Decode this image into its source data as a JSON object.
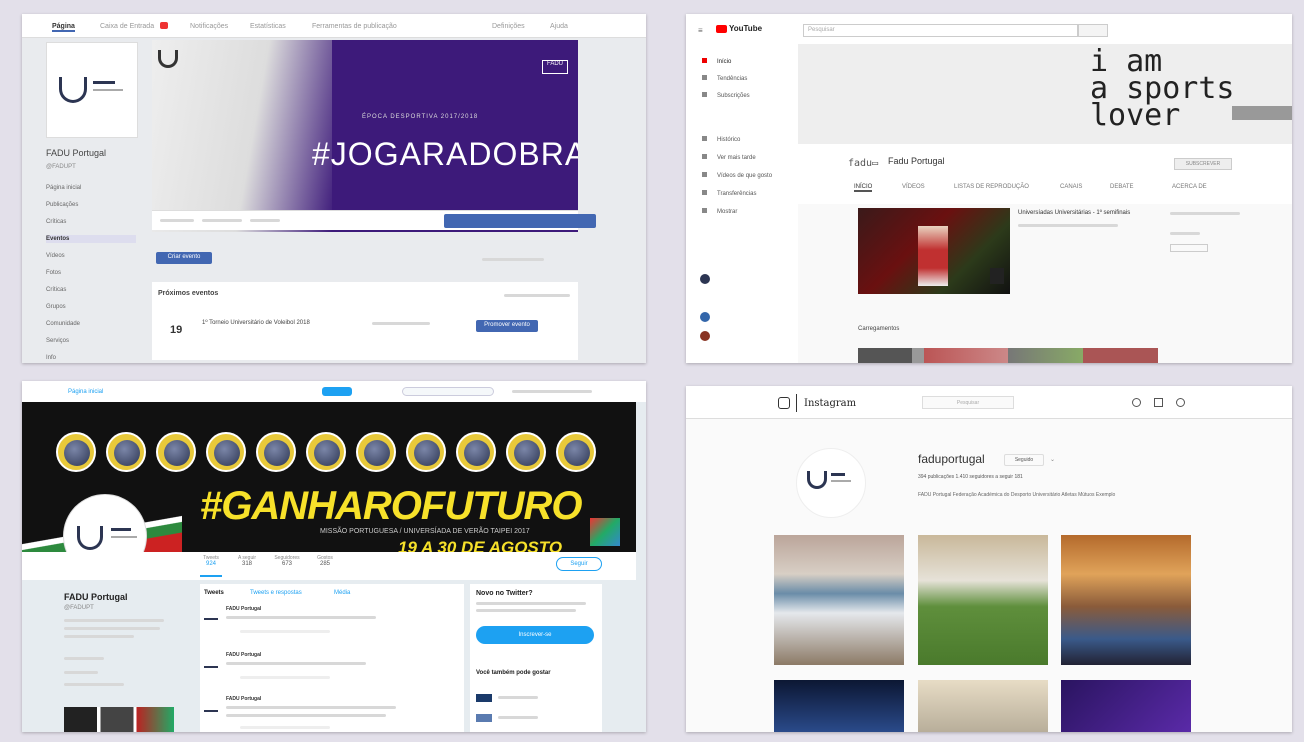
{
  "facebook": {
    "tabs": [
      "Página",
      "Caixa de Entrada",
      "Notificações",
      "Estatísticas",
      "Ferramentas de publicação",
      "Definições",
      "Ajuda"
    ],
    "page_name": "FADU Portugal",
    "handle": "@FADUPT",
    "nav": [
      "Página inicial",
      "Publicações",
      "Críticas",
      "Eventos",
      "Vídeos",
      "Fotos",
      "Críticas",
      "Grupos",
      "Comunidade",
      "Serviços",
      "Info"
    ],
    "nav_selected_index": 3,
    "cover_tagline": "ÉPOCA DESPORTIVA 2017/2018",
    "cover_hashtag": "#JOGARADOBRAR",
    "cover_badge": "FADU",
    "create_event": "Criar evento",
    "upcoming_title": "Próximos eventos",
    "event_day": "19",
    "event_title": "1º Torneio Universitário de Voleibol 2018",
    "promote": "Promover evento"
  },
  "youtube": {
    "logo": "YouTube",
    "search_placeholder": "Pesquisar",
    "nav": [
      "Início",
      "Tendências",
      "Subscrições",
      "Histórico",
      "Ver mais tarde",
      "Vídeos de que gosto",
      "Transferências",
      "Mostrar"
    ],
    "banner_text": "i am\na sports\nlover",
    "channel_name": "Fadu Portugal",
    "subscribe": "SUBSCREVER",
    "tabs": [
      "INÍCIO",
      "VÍDEOS",
      "LISTAS DE REPRODUÇÃO",
      "CANAIS",
      "DEBATE",
      "ACERCA DE"
    ],
    "video_title": "Universíadas Universitárias - 1º semifinais",
    "section": "Carregamentos"
  },
  "twitter": {
    "top_left": "Página inicial",
    "banner_hashtag": "#GANHAROFUTURO",
    "banner_sub": "MISSÃO PORTUGUESA / UNIVERSÍADA DE VERÃO TAIPEI 2017",
    "banner_date": "19 A 30 DE AGOSTO",
    "profile_name": "FADU Portugal",
    "handle": "@FADUPT",
    "stats": [
      {
        "label": "Tweets",
        "value": "924"
      },
      {
        "label": "A seguir",
        "value": "318"
      },
      {
        "label": "Seguidores",
        "value": "673"
      },
      {
        "label": "Gostos",
        "value": "285"
      }
    ],
    "follow": "Seguir",
    "feed_tabs": [
      "Tweets",
      "Tweets e respostas",
      "Média"
    ],
    "tweet_author": "FADU Portugal",
    "aside_title": "Novo no Twitter?",
    "aside_button": "Inscrever-se",
    "aside_suggest": "Você também pode gostar"
  },
  "instagram": {
    "brand": "Instagram",
    "search_placeholder": "Pesquisar",
    "username": "faduportugal",
    "follow_button": "Seguido",
    "stats": "394 publicações   1.410 seguidores   a seguir 181",
    "bio": "FADU Portugal Federação Académica do Desporto Universitário Atletas Mútuos Exemplo"
  },
  "colors": {
    "fb_blue": "#4267b2",
    "purple": "#3d1a7a",
    "yellow": "#f7e12a",
    "yt_red": "#ff0000",
    "tw_blue": "#1da1f2"
  }
}
